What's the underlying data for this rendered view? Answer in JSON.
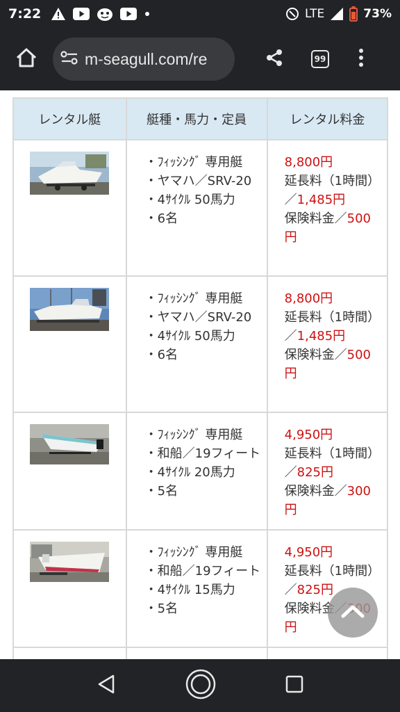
{
  "status_bar": {
    "time": "7:22",
    "network": "LTE",
    "battery": "73%"
  },
  "browser": {
    "url": "m-seagull.com/re",
    "tab_count": "99"
  },
  "table": {
    "headers": [
      "レンタル艇",
      "艇種・馬力・定員",
      "レンタル料金"
    ],
    "rows": [
      {
        "specs": [
          "・ﾌｨｯｼﾝｸﾞ 専用艇",
          "・ヤマハ／SRV-20",
          "・4ｻｲｸﾙ 50馬力",
          "・6名"
        ],
        "price": "8,800円",
        "ext_label": "延長料（1時間）／",
        "ext_price": "1,485円",
        "ins_label": "保険料金／",
        "ins_price": "500円"
      },
      {
        "specs": [
          "・ﾌｨｯｼﾝｸﾞ 専用艇",
          "・ヤマハ／SRV-20",
          "・4ｻｲｸﾙ 50馬力",
          "・6名"
        ],
        "price": "8,800円",
        "ext_label": "延長料（1時間）／",
        "ext_price": "1,485円",
        "ins_label": "保険料金／",
        "ins_price": "500円"
      },
      {
        "specs": [
          "・ﾌｨｯｼﾝｸﾞ 専用艇",
          "・和船／19フィート",
          "・4ｻｲｸﾙ 20馬力",
          "・5名"
        ],
        "price": "4,950円",
        "ext_label": "延長料（1時間）／",
        "ext_price": "825円",
        "ins_label": "保険料金／",
        "ins_price": "300円"
      },
      {
        "specs": [
          "・ﾌｨｯｼﾝｸﾞ 専用艇",
          "・和船／19フィート",
          "・4ｻｲｸﾙ 15馬力",
          "・5名"
        ],
        "price": "4,950円",
        "ext_label": "延長料（1時間）／",
        "ext_price": "825円",
        "ins_label": "保険料金／",
        "ins_price": "300円"
      }
    ]
  },
  "icons": {
    "home": "home-icon",
    "share": "share-icon",
    "menu": "more-vert-icon",
    "scroll_top": "chevron-up-icon",
    "back": "back-triangle-icon",
    "home_nav": "home-circle-icon",
    "recents": "recents-square-icon"
  },
  "colors": {
    "chrome": "#222326",
    "header_cell": "#d9e9f3",
    "price_red": "#cc1111"
  }
}
